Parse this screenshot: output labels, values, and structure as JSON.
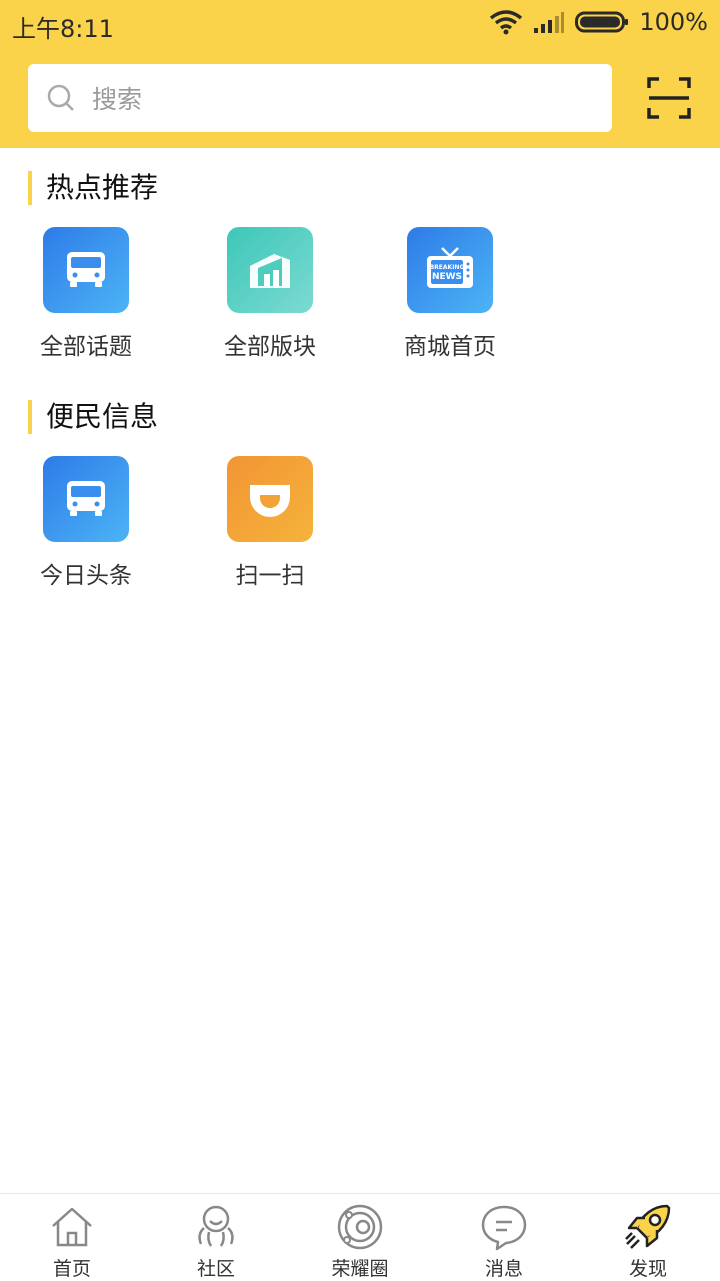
{
  "status_bar": {
    "time": "上午8:11",
    "battery": "100%"
  },
  "search": {
    "placeholder": "搜索"
  },
  "sections": [
    {
      "title": "热点推荐",
      "items": [
        {
          "label": "全部话题",
          "icon": "bus-icon"
        },
        {
          "label": "全部版块",
          "icon": "building-icon"
        },
        {
          "label": "商城首页",
          "icon": "breaking-news-tv-icon"
        }
      ]
    },
    {
      "title": "便民信息",
      "items": [
        {
          "label": "今日头条",
          "icon": "bus-icon"
        },
        {
          "label": "扫一扫",
          "icon": "didi-icon"
        }
      ]
    }
  ],
  "tv_text": {
    "line1": "BREAKING",
    "line2": "NEWS"
  },
  "tabs": [
    {
      "label": "首页",
      "icon": "home-icon"
    },
    {
      "label": "社区",
      "icon": "community-icon"
    },
    {
      "label": "荣耀圈",
      "icon": "planet-icon"
    },
    {
      "label": "消息",
      "icon": "chat-bubble-icon"
    },
    {
      "label": "发现",
      "icon": "rocket-icon",
      "active": true
    }
  ],
  "colors": {
    "accent": "#FBD34A",
    "blue": "#3A8FEE",
    "teal": "#4CCDBE",
    "orange": "#F3A236"
  }
}
